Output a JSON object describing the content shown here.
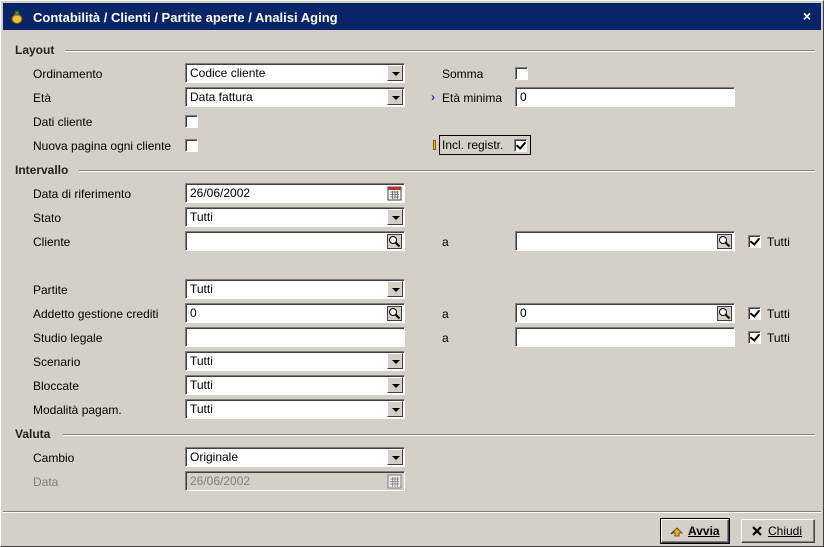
{
  "window": {
    "title": "Contabilità / Clienti / Partite aperte / Analisi Aging",
    "app_icon": "money-bag-icon",
    "close_symbol": "×"
  },
  "sections": {
    "layout": "Layout",
    "intervallo": "Intervallo",
    "valuta": "Valuta"
  },
  "layout": {
    "ordinamento": {
      "label": "Ordinamento",
      "value": "Codice cliente"
    },
    "eta": {
      "label": "Età",
      "value": "Data fattura"
    },
    "dati_cliente": {
      "label": "Dati cliente",
      "checked": false
    },
    "nuova_pagina": {
      "label": "Nuova pagina ogni cliente",
      "checked": false
    },
    "somma": {
      "label": "Somma",
      "checked": false
    },
    "eta_minima": {
      "marker": "›",
      "label": "Età minima",
      "value": "0"
    },
    "incl_registr": {
      "label": "Incl. registr.",
      "checked": true
    }
  },
  "intervallo": {
    "data_riferimento": {
      "label": "Data di riferimento",
      "value": "26/06/2002",
      "icon": "calendar-icon"
    },
    "stato": {
      "label": "Stato",
      "value": "Tutti"
    },
    "cliente": {
      "label": "Cliente",
      "from": "",
      "to_label": "a",
      "to": "",
      "all_label": "Tutti",
      "all_checked": true
    },
    "partite": {
      "label": "Partite",
      "value": "Tutti"
    },
    "addetto": {
      "label": "Addetto gestione crediti",
      "from": "0",
      "to_label": "a",
      "to": "0",
      "all_label": "Tutti",
      "all_checked": true
    },
    "studio_legale": {
      "label": "Studio legale",
      "from": "",
      "to_label": "a",
      "to": "",
      "all_label": "Tutti",
      "all_checked": true
    },
    "scenario": {
      "label": "Scenario",
      "value": "Tutti"
    },
    "bloccate": {
      "label": "Bloccate",
      "value": "Tutti"
    },
    "modalita": {
      "label": "Modalità pagam.",
      "value": "Tutti"
    }
  },
  "valuta": {
    "cambio": {
      "label": "Cambio",
      "value": "Originale"
    },
    "data": {
      "label": "Data",
      "value": "26/06/2002",
      "disabled": true
    }
  },
  "buttons": {
    "avvia": {
      "label": "Avvia",
      "icon": "run-icon"
    },
    "chiudi": {
      "label": "Chiudi",
      "icon": "close-icon"
    }
  }
}
